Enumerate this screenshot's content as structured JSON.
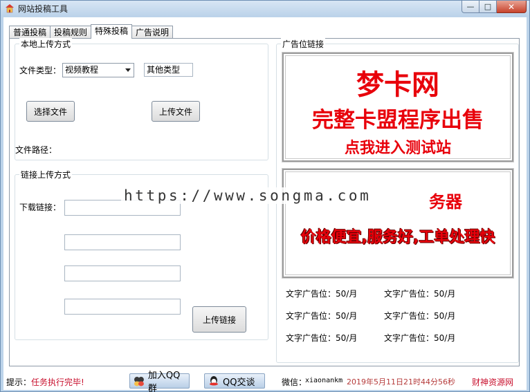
{
  "window": {
    "title": "网站投稿工具"
  },
  "tabs": [
    {
      "label": "普通投稿"
    },
    {
      "label": "投稿规则"
    },
    {
      "label": "特殊投稿"
    },
    {
      "label": "广告说明"
    }
  ],
  "local_upload": {
    "group_label": "本地上传方式",
    "file_type_label": "文件类型：",
    "file_type_value": "视频教程",
    "other_type_value": "其他类型",
    "choose_file_button": "选择文件",
    "upload_file_button": "上传文件",
    "file_path_label": "文件路径："
  },
  "link_upload": {
    "group_label": "链接上传方式",
    "download_link_label": "下载链接：",
    "upload_link_button": "上传链接"
  },
  "ads": {
    "group_label": "广告位链接",
    "banner1": {
      "line1": "梦卡网",
      "line2": "完整卡盟程序出售",
      "line3": "点我进入测试站"
    },
    "banner2": {
      "line1_tail": "务器",
      "line2": "价格便宜,服务好,工单处理快"
    },
    "text_ads": [
      "文字广告位：50/月",
      "文字广告位：50/月",
      "文字广告位：50/月",
      "文字广告位：50/月",
      "文字广告位：50/月",
      "文字广告位：50/月"
    ]
  },
  "watermark": "https://www.songma.com",
  "status": {
    "hint_label": "提示：",
    "hint_text": "任务执行完毕!",
    "join_qq_group": "加入QQ群",
    "qq_chat": "QQ交谈",
    "wechat_label": "微信：",
    "wechat_id": "xiaonankm",
    "datetime": "2019年5月11日21时44分56秒",
    "site": "财神资源网"
  },
  "colors": {
    "accent_red": "#e8000b",
    "status_red": "#c8102e",
    "titlebar": "#bcd3ea"
  }
}
